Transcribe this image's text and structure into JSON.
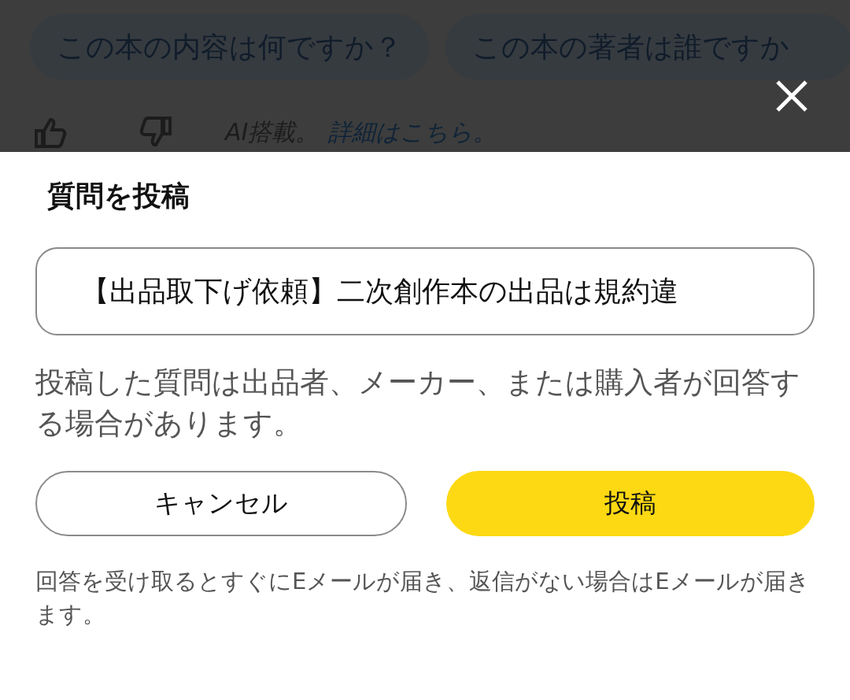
{
  "background_page": {
    "suggestion_chips": [
      "この本の内容は何ですか？",
      "この本の著者は誰ですか"
    ],
    "feedback": {
      "ai_note": "AI搭載。",
      "details_link": "詳細はこちら。"
    }
  },
  "dialog": {
    "title": "質問を投稿",
    "question_field": {
      "value": "【出品取下げ依頼】二次創作本の出品は規約違"
    },
    "description": "投稿した質問は出品者、メーカー、または購入者が回答する場合があります。",
    "buttons": [
      {
        "label": "キャンセル",
        "kind": "secondary"
      },
      {
        "label": "投稿",
        "kind": "primary"
      }
    ],
    "footnote": "回答を受け取るとすぐにEメールが届き、返信がない場合はEメールが届きます。"
  }
}
